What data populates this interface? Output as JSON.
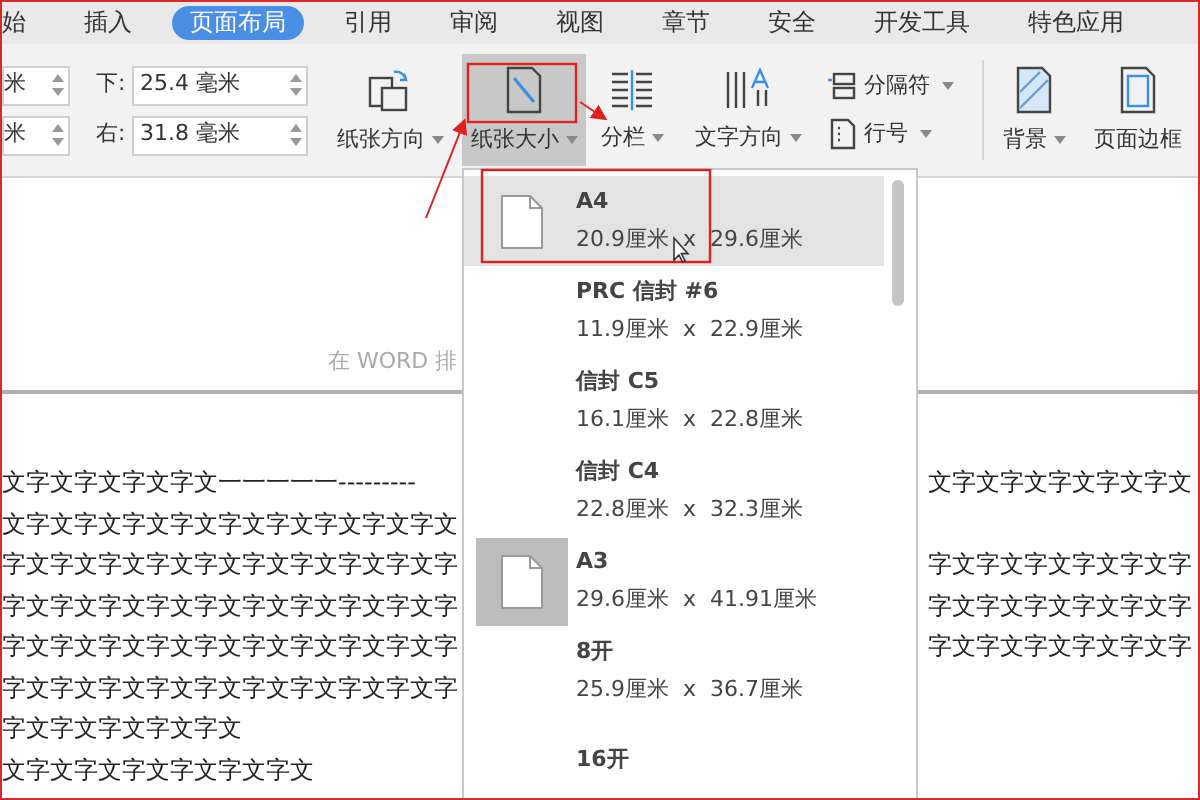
{
  "tabs": [
    {
      "label": "始",
      "selected": false
    },
    {
      "label": "插入",
      "selected": false
    },
    {
      "label": "页面布局",
      "selected": true
    },
    {
      "label": "引用",
      "selected": false
    },
    {
      "label": "审阅",
      "selected": false
    },
    {
      "label": "视图",
      "selected": false
    },
    {
      "label": "章节",
      "selected": false
    },
    {
      "label": "安全",
      "selected": false
    },
    {
      "label": "开发工具",
      "selected": false
    },
    {
      "label": "特色应用",
      "selected": false
    }
  ],
  "margin_rows": [
    {
      "left_value": "米",
      "label": "下:",
      "value": "25.4 毫米"
    },
    {
      "left_value": "米",
      "label": "右:",
      "value": "31.8 毫米"
    }
  ],
  "ribbon_buttons": [
    {
      "kind": "large",
      "label": "纸张方向",
      "dropdown": true,
      "selected": false
    },
    {
      "kind": "large",
      "label": "纸张大小",
      "dropdown": true,
      "selected": true
    },
    {
      "kind": "large",
      "label": "分栏",
      "dropdown": true,
      "selected": false
    },
    {
      "kind": "large",
      "label": "文字方向",
      "dropdown": true,
      "selected": false
    },
    {
      "kind": "stack",
      "items": [
        {
          "label": "分隔符",
          "dropdown": true
        },
        {
          "label": "行号",
          "dropdown": true
        }
      ]
    },
    {
      "kind": "large",
      "label": "背景",
      "dropdown": true,
      "selected": false
    },
    {
      "kind": "large",
      "label": "页面边框",
      "dropdown": false,
      "selected": false
    }
  ],
  "document": {
    "caption": "在 WORD 排",
    "lines": [
      {
        "left": "文字文字文字文字文一一一一一---------",
        "right": "文字文字文字文字文字文"
      },
      {
        "left": "文字文字文字文字文字文字文字文字文字文"
      },
      {
        "left": "字文字文字文字文字文字文字文字文字文字",
        "right": "字文字文字文字文字文字"
      },
      {
        "left": "字文字文字文字文字文字文字文字文字文字",
        "right": "字文字文字文字文字文字"
      },
      {
        "left": "字文字文字文字文字文字文字文字文字文字",
        "right": "字文字文字文字文字文字"
      },
      {
        "left": "字文字文字文字文字文字文字文字文字文字"
      },
      {
        "left": "字文字文字文字文字文"
      },
      {
        "left": "文字文字文字文字文字文字文"
      }
    ]
  },
  "paper_menu": [
    {
      "name": "A4",
      "width": "20.9厘米",
      "times": "x",
      "height": "29.6厘米",
      "selected": true,
      "icon": true,
      "icon_highlighted": false
    },
    {
      "name": "PRC 信封 #6",
      "width": "11.9厘米",
      "times": "x",
      "height": "22.9厘米",
      "selected": false,
      "icon": false
    },
    {
      "name": "信封 C5",
      "width": "16.1厘米",
      "times": "x",
      "height": "22.8厘米",
      "selected": false,
      "icon": false
    },
    {
      "name": "信封 C4",
      "width": "22.8厘米",
      "times": "x",
      "height": "32.3厘米",
      "selected": false,
      "icon": false
    },
    {
      "name": "A3",
      "width": "29.6厘米",
      "times": "x",
      "height": "41.91厘米",
      "selected": false,
      "icon": true,
      "icon_highlighted": true
    },
    {
      "name": "8开",
      "width": "25.9厘米",
      "times": "x",
      "height": "36.7厘米",
      "selected": false,
      "icon": false
    },
    {
      "name": "16开",
      "selected": false,
      "icon": false
    }
  ]
}
